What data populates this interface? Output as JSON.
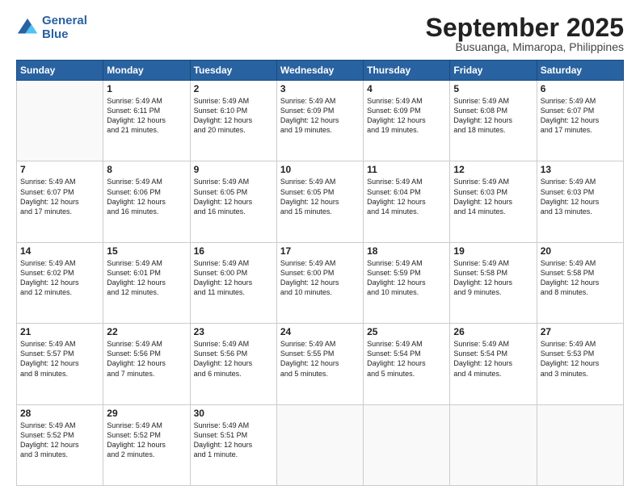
{
  "header": {
    "logo_line1": "General",
    "logo_line2": "Blue",
    "month": "September 2025",
    "location": "Busuanga, Mimaropa, Philippines"
  },
  "weekdays": [
    "Sunday",
    "Monday",
    "Tuesday",
    "Wednesday",
    "Thursday",
    "Friday",
    "Saturday"
  ],
  "rows": [
    [
      {
        "day": "",
        "text": ""
      },
      {
        "day": "1",
        "text": "Sunrise: 5:49 AM\nSunset: 6:11 PM\nDaylight: 12 hours\nand 21 minutes."
      },
      {
        "day": "2",
        "text": "Sunrise: 5:49 AM\nSunset: 6:10 PM\nDaylight: 12 hours\nand 20 minutes."
      },
      {
        "day": "3",
        "text": "Sunrise: 5:49 AM\nSunset: 6:09 PM\nDaylight: 12 hours\nand 19 minutes."
      },
      {
        "day": "4",
        "text": "Sunrise: 5:49 AM\nSunset: 6:09 PM\nDaylight: 12 hours\nand 19 minutes."
      },
      {
        "day": "5",
        "text": "Sunrise: 5:49 AM\nSunset: 6:08 PM\nDaylight: 12 hours\nand 18 minutes."
      },
      {
        "day": "6",
        "text": "Sunrise: 5:49 AM\nSunset: 6:07 PM\nDaylight: 12 hours\nand 17 minutes."
      }
    ],
    [
      {
        "day": "7",
        "text": "Sunrise: 5:49 AM\nSunset: 6:07 PM\nDaylight: 12 hours\nand 17 minutes."
      },
      {
        "day": "8",
        "text": "Sunrise: 5:49 AM\nSunset: 6:06 PM\nDaylight: 12 hours\nand 16 minutes."
      },
      {
        "day": "9",
        "text": "Sunrise: 5:49 AM\nSunset: 6:05 PM\nDaylight: 12 hours\nand 16 minutes."
      },
      {
        "day": "10",
        "text": "Sunrise: 5:49 AM\nSunset: 6:05 PM\nDaylight: 12 hours\nand 15 minutes."
      },
      {
        "day": "11",
        "text": "Sunrise: 5:49 AM\nSunset: 6:04 PM\nDaylight: 12 hours\nand 14 minutes."
      },
      {
        "day": "12",
        "text": "Sunrise: 5:49 AM\nSunset: 6:03 PM\nDaylight: 12 hours\nand 14 minutes."
      },
      {
        "day": "13",
        "text": "Sunrise: 5:49 AM\nSunset: 6:03 PM\nDaylight: 12 hours\nand 13 minutes."
      }
    ],
    [
      {
        "day": "14",
        "text": "Sunrise: 5:49 AM\nSunset: 6:02 PM\nDaylight: 12 hours\nand 12 minutes."
      },
      {
        "day": "15",
        "text": "Sunrise: 5:49 AM\nSunset: 6:01 PM\nDaylight: 12 hours\nand 12 minutes."
      },
      {
        "day": "16",
        "text": "Sunrise: 5:49 AM\nSunset: 6:00 PM\nDaylight: 12 hours\nand 11 minutes."
      },
      {
        "day": "17",
        "text": "Sunrise: 5:49 AM\nSunset: 6:00 PM\nDaylight: 12 hours\nand 10 minutes."
      },
      {
        "day": "18",
        "text": "Sunrise: 5:49 AM\nSunset: 5:59 PM\nDaylight: 12 hours\nand 10 minutes."
      },
      {
        "day": "19",
        "text": "Sunrise: 5:49 AM\nSunset: 5:58 PM\nDaylight: 12 hours\nand 9 minutes."
      },
      {
        "day": "20",
        "text": "Sunrise: 5:49 AM\nSunset: 5:58 PM\nDaylight: 12 hours\nand 8 minutes."
      }
    ],
    [
      {
        "day": "21",
        "text": "Sunrise: 5:49 AM\nSunset: 5:57 PM\nDaylight: 12 hours\nand 8 minutes."
      },
      {
        "day": "22",
        "text": "Sunrise: 5:49 AM\nSunset: 5:56 PM\nDaylight: 12 hours\nand 7 minutes."
      },
      {
        "day": "23",
        "text": "Sunrise: 5:49 AM\nSunset: 5:56 PM\nDaylight: 12 hours\nand 6 minutes."
      },
      {
        "day": "24",
        "text": "Sunrise: 5:49 AM\nSunset: 5:55 PM\nDaylight: 12 hours\nand 5 minutes."
      },
      {
        "day": "25",
        "text": "Sunrise: 5:49 AM\nSunset: 5:54 PM\nDaylight: 12 hours\nand 5 minutes."
      },
      {
        "day": "26",
        "text": "Sunrise: 5:49 AM\nSunset: 5:54 PM\nDaylight: 12 hours\nand 4 minutes."
      },
      {
        "day": "27",
        "text": "Sunrise: 5:49 AM\nSunset: 5:53 PM\nDaylight: 12 hours\nand 3 minutes."
      }
    ],
    [
      {
        "day": "28",
        "text": "Sunrise: 5:49 AM\nSunset: 5:52 PM\nDaylight: 12 hours\nand 3 minutes."
      },
      {
        "day": "29",
        "text": "Sunrise: 5:49 AM\nSunset: 5:52 PM\nDaylight: 12 hours\nand 2 minutes."
      },
      {
        "day": "30",
        "text": "Sunrise: 5:49 AM\nSunset: 5:51 PM\nDaylight: 12 hours\nand 1 minute."
      },
      {
        "day": "",
        "text": ""
      },
      {
        "day": "",
        "text": ""
      },
      {
        "day": "",
        "text": ""
      },
      {
        "day": "",
        "text": ""
      }
    ]
  ]
}
